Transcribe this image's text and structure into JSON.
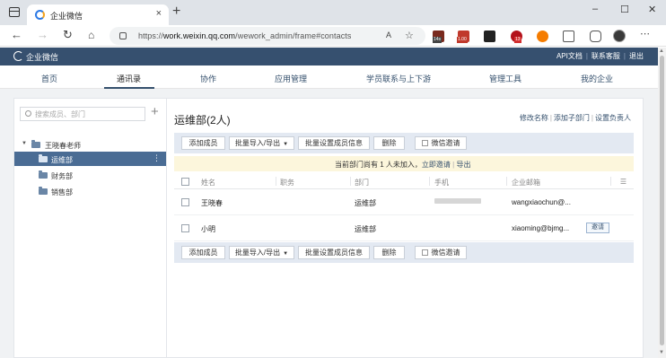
{
  "browser": {
    "tab_title": "企业微信",
    "tab_close": "×",
    "new_tab": "+",
    "url_prefix": "https://",
    "url_host": "work.weixin.qq.com",
    "url_path": "/wework_admin/frame#contacts",
    "read_aloud": "A",
    "window_controls": [
      "–",
      "☐",
      "✕"
    ],
    "ext_badges": [
      "14s",
      "1.00",
      "13"
    ]
  },
  "app_header": {
    "logo_text": "企业微信",
    "links": [
      "API文档",
      "联系客服",
      "退出"
    ]
  },
  "topnav": {
    "items": [
      "首页",
      "通讯录",
      "协作",
      "应用管理",
      "学员联系与上下游",
      "管理工具",
      "我的企业"
    ],
    "active": "通讯录"
  },
  "sidebar": {
    "search_placeholder": "搜索成员、部门",
    "add_label": "+",
    "root": "王晓春老师",
    "departments": [
      "运维部",
      "财务部",
      "销售部"
    ],
    "selected": "运维部",
    "more_label": "⋮"
  },
  "main": {
    "title": "运维部(2人)",
    "actions": [
      "修改名称",
      "添加子部门",
      "设置负责人"
    ],
    "buttons": {
      "add_member": "添加成员",
      "batch_import_export": "批量导入/导出",
      "batch_set": "批量设置成员信息",
      "delete": "删除",
      "wechat_invite": "微信邀请"
    },
    "notice": {
      "text": "当前部门尚有 1 人未加入",
      "invite_link": "立即邀请",
      "separator": "|",
      "export_link": "导出"
    },
    "columns": [
      "姓名",
      "职务",
      "部门",
      "手机",
      "企业邮箱"
    ],
    "rows": [
      {
        "name": "王晓春",
        "title": "",
        "dept": "运维部",
        "phone": "",
        "email": "wangxiaochun@..."
      },
      {
        "name": "小明",
        "title": "",
        "dept": "运维部",
        "phone": "",
        "email": "xiaoming@bjmg...",
        "invite": "邀请"
      }
    ]
  },
  "colors": {
    "header_bg": "#36506f",
    "accent": "#35506d",
    "selected_dept": "#4a6c94",
    "action_bar": "#e3e9f2",
    "notice_bg": "#fcf6dc"
  }
}
